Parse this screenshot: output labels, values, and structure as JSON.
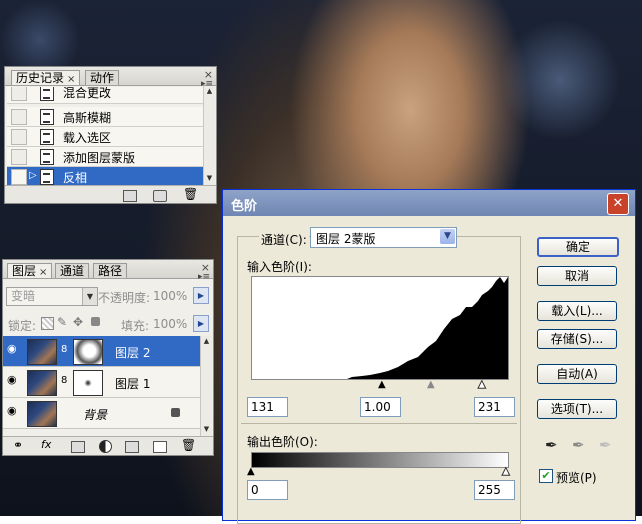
{
  "history_panel": {
    "tabs": [
      {
        "label": "历史记录",
        "close": "×"
      },
      {
        "label": "动作"
      }
    ],
    "close_glyph": "×",
    "items": [
      {
        "label": "混合更改"
      },
      {
        "label": "高斯模糊"
      },
      {
        "label": "载入选区"
      },
      {
        "label": "添加图层蒙版"
      },
      {
        "label": "反相"
      }
    ]
  },
  "layers_panel": {
    "tabs": [
      {
        "label": "图层",
        "close": "×"
      },
      {
        "label": "通道"
      },
      {
        "label": "路径"
      }
    ],
    "close_glyph": "×",
    "blend_mode": "变暗",
    "opacity_label": "不透明度:",
    "opacity_value": "100%",
    "lock_label": "锁定:",
    "fill_label": "填充:",
    "fill_value": "100%",
    "layers": [
      {
        "name": "图层 2"
      },
      {
        "name": "图层 1"
      },
      {
        "name": "背景"
      }
    ]
  },
  "levels_dialog": {
    "title": "色阶",
    "close_glyph": "✕",
    "channel_label": "通道(C):",
    "channel_value": "图层 2蒙版",
    "input_label": "输入色阶(I):",
    "input_black": "131",
    "input_gamma": "1.00",
    "input_white": "231",
    "output_label": "输出色阶(O):",
    "output_black": "0",
    "output_white": "255",
    "buttons": {
      "ok": "确定",
      "cancel": "取消",
      "load": "载入(L)...",
      "save": "存储(S)...",
      "auto": "自动(A)",
      "options": "选项(T)..."
    },
    "preview_label": "预览(P)",
    "preview_checked": true
  }
}
